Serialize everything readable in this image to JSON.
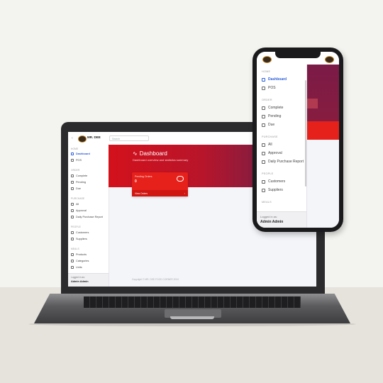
{
  "laptop": {
    "brand": "MR. DEE",
    "search_placeholder": "Search",
    "nav": [
      {
        "section": "HOME",
        "items": [
          {
            "label": "Dashboard",
            "icon": "activity-icon",
            "active": true
          },
          {
            "label": "POS",
            "icon": "calculator-icon"
          }
        ]
      },
      {
        "section": "ORDER",
        "items": [
          {
            "label": "Complete",
            "icon": "gear-icon"
          },
          {
            "label": "Pending",
            "icon": "gear-icon"
          },
          {
            "label": "Due",
            "icon": "monitor-icon"
          }
        ]
      },
      {
        "section": "PURCHASE",
        "items": [
          {
            "label": "All",
            "icon": "gear-icon"
          },
          {
            "label": "Approval",
            "icon": "gear-icon"
          },
          {
            "label": "Daily Purchase Report",
            "icon": "monitor-icon"
          }
        ]
      },
      {
        "section": "PEOPLE",
        "items": [
          {
            "label": "Customers",
            "icon": "users-icon"
          },
          {
            "label": "Suppliers",
            "icon": "users-icon"
          }
        ]
      },
      {
        "section": "MEALS",
        "items": [
          {
            "label": "Products",
            "icon": "box-icon"
          },
          {
            "label": "Categories",
            "icon": "folder-icon"
          },
          {
            "label": "Units",
            "icon": "folder-icon"
          }
        ]
      }
    ],
    "footer": {
      "label": "Logged in as:",
      "user": "Admin Admin"
    },
    "page": {
      "title": "Dashboard",
      "subtitle": "Dashboard overview and statistics summary"
    },
    "card": {
      "label": "Pending Orders",
      "value": "0",
      "link": "View Orders"
    },
    "copyright": "Copyright © MR. DEE FOOD CORNER 2024"
  },
  "phone": {
    "nav": [
      {
        "section": "HOME",
        "items": [
          {
            "label": "Dashboard",
            "icon": "activity-icon",
            "active": true
          },
          {
            "label": "POS",
            "icon": "calculator-icon"
          }
        ]
      },
      {
        "section": "ORDER",
        "items": [
          {
            "label": "Complete",
            "icon": "gear-icon"
          },
          {
            "label": "Pending",
            "icon": "gear-icon"
          },
          {
            "label": "Due",
            "icon": "monitor-icon"
          }
        ]
      },
      {
        "section": "PURCHASE",
        "items": [
          {
            "label": "All",
            "icon": "gear-icon"
          },
          {
            "label": "Approval",
            "icon": "gear-icon"
          },
          {
            "label": "Daily Purchase Report",
            "icon": "monitor-icon"
          }
        ]
      },
      {
        "section": "PEOPLE",
        "items": [
          {
            "label": "Customers",
            "icon": "users-icon"
          },
          {
            "label": "Suppliers",
            "icon": "users-icon"
          }
        ]
      },
      {
        "section": "MEALS",
        "items": []
      }
    ],
    "footer": {
      "label": "Logged in as:",
      "user": "Admin Admin"
    }
  },
  "colors": {
    "accent": "#2b5fd9",
    "hero_red": "#d3111c",
    "card_red": "#e6201b"
  }
}
